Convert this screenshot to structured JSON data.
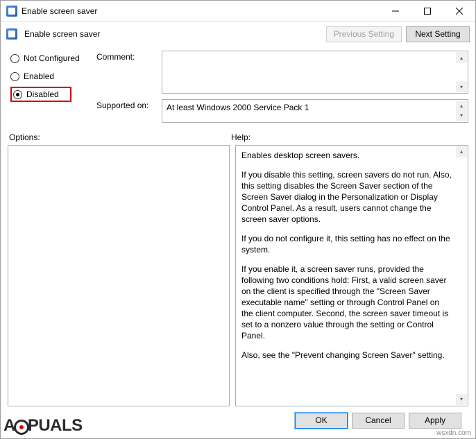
{
  "window": {
    "title": "Enable screen saver"
  },
  "toolbar": {
    "title": "Enable screen saver",
    "prev": "Previous Setting",
    "next": "Next Setting"
  },
  "radios": {
    "not_configured": "Not Configured",
    "enabled": "Enabled",
    "disabled": "Disabled",
    "selected": "disabled"
  },
  "fields": {
    "comment_label": "Comment:",
    "comment_value": "",
    "supported_label": "Supported on:",
    "supported_value": "At least Windows 2000 Service Pack 1"
  },
  "sections": {
    "options": "Options:",
    "help": "Help:"
  },
  "help": {
    "p1": "Enables desktop screen savers.",
    "p2": "If you disable this setting, screen savers do not run. Also, this setting disables the Screen Saver section of the Screen Saver dialog in the Personalization or Display Control Panel. As a result, users cannot change the screen saver options.",
    "p3": "If you do not configure it, this setting has no effect on the system.",
    "p4": "If you enable it, a screen saver runs, provided the following two conditions hold: First, a valid screen saver on the client is specified through the \"Screen Saver executable name\" setting or through Control Panel on the client computer. Second, the screen saver timeout is set to a nonzero value through the setting or Control Panel.",
    "p5": "Also, see the \"Prevent changing Screen Saver\" setting."
  },
  "buttons": {
    "ok": "OK",
    "cancel": "Cancel",
    "apply": "Apply"
  },
  "watermark": {
    "pre": "A",
    "mid": "PUALS",
    "site": "wsxdn.com"
  }
}
